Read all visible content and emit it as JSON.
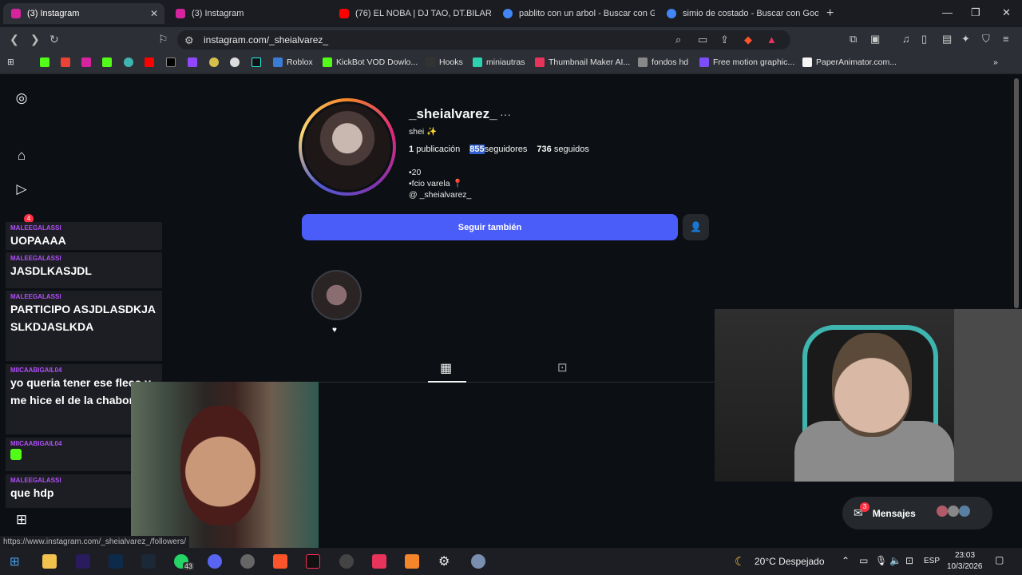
{
  "browser": {
    "tabs": [
      {
        "label": "(3) Instagram",
        "color": "#d6249f"
      },
      {
        "label": "(3) Instagram",
        "color": "#d6249f"
      },
      {
        "label": "(76) EL NOBA | DJ TAO, DT.BILARDO",
        "color": "#ff0000"
      },
      {
        "label": "pablito con un arbol - Buscar con Go",
        "color": "#4285f4"
      },
      {
        "label": "simio de costado - Buscar con Googl",
        "color": "#4285f4"
      }
    ],
    "url": "instagram.com/_sheialvarez_",
    "bookmarks": [
      "Roblox",
      "KickBot VOD Dowlo...",
      "Hooks",
      "miniautras",
      "Thumbnail Maker AI...",
      "fondos hd",
      "Free motion graphic...",
      "PaperAnimator.com..."
    ]
  },
  "profile": {
    "username": "_sheialvarez_",
    "name": "shei ✨",
    "posts": "1",
    "posts_label": "publicación",
    "followers": "855",
    "followers_label": "seguidores",
    "following": "736",
    "following_label": "seguidos",
    "bio1": "•20",
    "bio2": "•fcio varela 📍",
    "threads": "_sheialvarez_",
    "follow_button": "Seguir también",
    "highlight_label": "♥"
  },
  "chat": [
    {
      "user": "MALEEGALASSI",
      "text": "UOPAAAA"
    },
    {
      "user": "MALEEGALASSI",
      "text": "JASDLKASJDL"
    },
    {
      "user": "MALEEGALASSI",
      "text": "PARTICIPO ASJDLASDKJASLKDJASLKDA"
    },
    {
      "user": "MIICAABIGAIL04",
      "text": "yo queria tener ese fleco y me hice el de la chabona"
    },
    {
      "user": "MIICAABIGAIL04",
      "text": ""
    },
    {
      "user": "MALEEGALASSI",
      "text": "que hdp"
    }
  ],
  "sidebar_badge": "4",
  "messages": {
    "label": "Mensajes",
    "badge": "3"
  },
  "status_url": "https://www.instagram.com/_sheialvarez_/followers/",
  "taskbar": {
    "weather": "20°C  Despejado",
    "lang": "ESP",
    "time": "23:03",
    "date": "10/3/2026",
    "badge": "43"
  }
}
